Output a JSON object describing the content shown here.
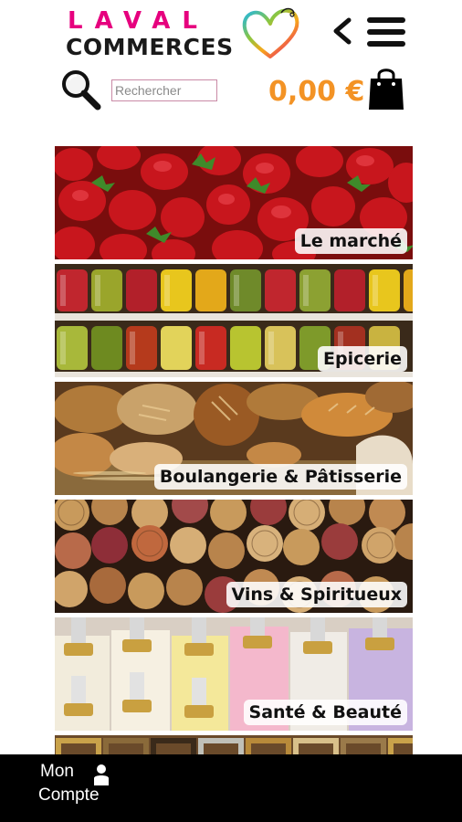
{
  "header": {
    "logo_line1": "LAVAL",
    "logo_line2": "COMMERCES",
    "back_icon": "chevron-left-icon",
    "menu_icon": "hamburger-menu-icon"
  },
  "search": {
    "placeholder": "Rechercher",
    "value": "",
    "icon": "magnifier-icon"
  },
  "cart": {
    "total": "0,00 €",
    "icon": "shopping-bag-icon"
  },
  "categories": [
    {
      "label": "Le marché",
      "image": "strawberries"
    },
    {
      "label": "Epicerie",
      "image": "jars-on-shelves"
    },
    {
      "label": "Boulangerie & Pâtisserie",
      "image": "breads-and-croissants"
    },
    {
      "label": "Vins & Spiritueux",
      "image": "wine-corks"
    },
    {
      "label": "Santé & Beauté",
      "image": "lotion-bottles"
    },
    {
      "label": "",
      "image": "picture-frames"
    }
  ],
  "footer": {
    "account_line1": "Mon",
    "account_line2": "Compte",
    "account_icon": "user-icon"
  },
  "colors": {
    "brand_pink": "#e6007e",
    "cart_orange": "#f39325",
    "footer_bg": "#000000"
  }
}
